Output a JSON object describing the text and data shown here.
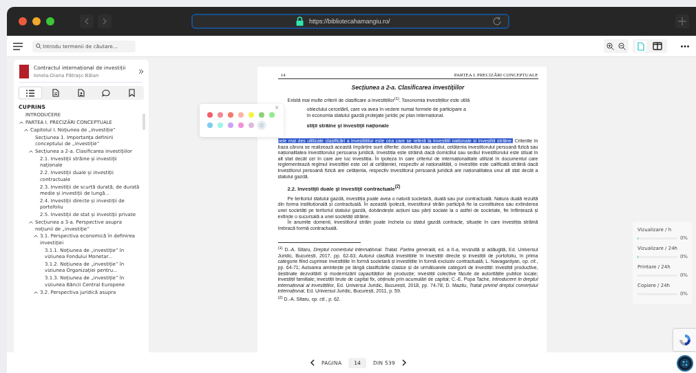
{
  "browser": {
    "url": "https://bibliotecahamangiu.ro/"
  },
  "toolbar": {
    "search": {
      "placeholder": "Introdu termenii de căutare..."
    },
    "view_modes": [
      {
        "kind": "single",
        "selected": true
      },
      {
        "kind": "double",
        "selected": false
      }
    ]
  },
  "book": {
    "title": "Contractul internațional de investiții",
    "author": "Ionela-Diana Pătrașc-Bălan"
  },
  "sidebar_tabs": [
    {
      "kind": "toc",
      "selected": true
    },
    {
      "kind": "page",
      "selected": false
    },
    {
      "kind": "document",
      "selected": false
    },
    {
      "kind": "comments",
      "selected": false
    },
    {
      "kind": "bookmarks",
      "selected": false
    }
  ],
  "toc": {
    "heading": "CUPRINS",
    "items": [
      {
        "label": "INTRODUCERE"
      },
      {
        "label": "PARTEA I. PRECIZĂRI CONCEPTUALE",
        "expanded": true,
        "children": [
          {
            "label": "Capitolul I. Noțiunea de „investiție”",
            "expanded": true,
            "children": [
              {
                "label": "Secțiunea 1. Importanța definirii conceptului de „investiție”"
              },
              {
                "label": "Secțiunea a 2-a. Clasificarea investițiilor",
                "expanded": true,
                "children": [
                  {
                    "label": "2.1. Investiții străine și investiții naționale"
                  },
                  {
                    "label": "2.2. Investiții duale și investiții contractuale"
                  },
                  {
                    "label": "2.3. Investiții de scurtă durată, de durată medie și investiții de lungă..."
                  },
                  {
                    "label": "2.4. Investiții directe și investiții de portofoliu"
                  },
                  {
                    "label": "2.5. Investiții de stat și investiții private"
                  }
                ]
              },
              {
                "label": "Secțiunea a 3-a. Perspective asupra noțiunii de „investiție”",
                "expanded": true,
                "children": [
                  {
                    "label": "3.1. Perspectiva economică în definirea investiției",
                    "expanded": true,
                    "children": [
                      {
                        "label": "3.1.1. Noțiunea de „investiție” în viziunea Fondului Monetar..."
                      },
                      {
                        "label": "3.1.2. Noțiunea de „investiție” în viziunea Organizației pentru..."
                      },
                      {
                        "label": "3.1.3. Noțiunea de „investiție” în viziunea Băncii Central Europene"
                      }
                    ]
                  },
                  {
                    "label": "3.2. Perspectiva juridică asupra",
                    "expanded": true
                  }
                ]
              }
            ]
          }
        ]
      }
    ]
  },
  "page": {
    "number": "14",
    "running_title": "PARTEA I. PRECIZĂRI CONCEPTUALE",
    "title": "Secțiunea a 2-a. Clasificarea investițiilor",
    "blocks": [
      {
        "kind": "line",
        "text": "Există mai multe criterii de clasificare a investițiilor$^{(1)}$. Taxonomia investițiilor este utilă"
      },
      {
        "kind": "partial_line",
        "text": "obiectului cercetării, care va avea în vedere numai formele de participare a"
      },
      {
        "kind": "partial_line",
        "text": "în economia statului gazdă protejate juridic pe plan internațional."
      },
      {
        "kind": "partial_heading",
        "text": "stiții străine și investiții naționale"
      },
      {
        "kind": "highlighted_paragraph",
        "highlight": "cele mai des utilizate clasificări a investițiilor este cea care se referă la investiții naționale și investiții străine.",
        "text": "Criteriile în baza cărora se realizează această împărțire sunt diferite: domiciliul sau sediul, cetățenia investitorului persoană fizică sau naționalitatea investitorului persoana juridică. Investiția este străină dacă domiciliul sau sediul investitorului este situat în alt stat decât cel în care are loc investiția. În ipoteza în care criteriul de internaționalitate utilizat în documentul care reglementează regimul investiției este cel al cetățeniei, respectiv al naționalității, o investiție este calificată străină dacă investitorul persoană fizică are cetățenia, respectiv investitorul persoană juridică are naționalitatea unui alt stat decât a statului gazdă."
      },
      {
        "kind": "heading",
        "text": "2.2. Investiții duale și investiții contractuale$^{(2)}$"
      },
      {
        "kind": "paragraph",
        "text": "Pe teritoriul statului gazdă, investiția poate avea o natură societară, duală sau pur contractuală. Natura duală rezultă din forma instituțională și contractuală. În această ipoteză, investitorul străin participă fie la constituirea sau extinderea unei societăți pe teritoriul statului gazdă, dobândește acțiuni sau părți sociale la o astfel de societate, fie înființează și extinde o sucursală a unei societăți străine."
      },
      {
        "kind": "paragraph",
        "text": "În anumite domenii, investitorul străin poate încheia cu statul gazdă contracte, situație în care investiția străină îmbracă formă contractuală."
      }
    ],
    "footnotes": [
      "$^{(1)}$ D.-A. Sitaru, *Dreptul comerțului internațional. Tratat. Partea generală*, ed. a II-a, revizuită și adăugită, Ed. Universul Juridic, București, 2017, pp. 62-63; Autorul clasifică investițiile în investiții directe și investiții de portofoliu, în prima categorie fiind cuprinse investițiile în formă societară și investițiile în formă exclusiv contractuală; L. Navagardyan, *op. cit.*, pp. 64-71; Autoarea amintește pe lângă clasificările clasice și de următoarele categorii de investiții: investiții productive, destinate dezvoltării și modernizării capacităților de producție; investiții colective făcute de autoritățile publice locale; investiții familiale; investiții brute de capital fix, obținute prin acumulări de capital; C.-E. Popa Tache, *Introducere în dreptul internațional al investițiilor*, Ed. Universul Juridic, București, 2018, pp. 74-78; D. Mazilu, *Tratat privind dreptul comerțului internațional*, Ed. Universul Juridic, București, 2011, p. 59.",
      "$^{(2)}$ D.-A. Sitaru, *op. cit.*, p. 62."
    ]
  },
  "highlight_popover": {
    "close": "×",
    "colors": [
      {
        "color": "#f25c6b",
        "selected": false
      },
      {
        "color": "#f28b95",
        "selected": false
      },
      {
        "color": "#f7786b",
        "selected": false
      },
      {
        "color": "#fbb5a6",
        "selected": false
      },
      {
        "color": "#f5f542",
        "selected": false
      },
      {
        "color": "#8fd17a",
        "selected": false
      },
      {
        "color": "#93eb8e",
        "selected": false
      },
      {
        "color": "#7ccdf2",
        "selected": false
      },
      {
        "color": "#9ef5ea",
        "selected": false
      },
      {
        "color": "#c9a5f5",
        "selected": false
      },
      {
        "color": "#f291d8",
        "selected": false
      },
      {
        "color": "#ddb9de",
        "selected": false
      },
      {
        "color": "#cfdde3",
        "selected": true
      }
    ]
  },
  "stats": [
    {
      "label": "Vizualizare / h",
      "level": 0.01,
      "reading": "0%"
    },
    {
      "label": "Vizualizare / 24h",
      "level": 0.01,
      "reading": "0%"
    },
    {
      "label": "Printare / 24h",
      "level": 0,
      "reading": "0%"
    },
    {
      "label": "Copiere / 24h",
      "level": 0,
      "reading": "0%"
    }
  ],
  "pagination": {
    "label": "PAGINA",
    "current": "14",
    "total": "DIN 539"
  }
}
